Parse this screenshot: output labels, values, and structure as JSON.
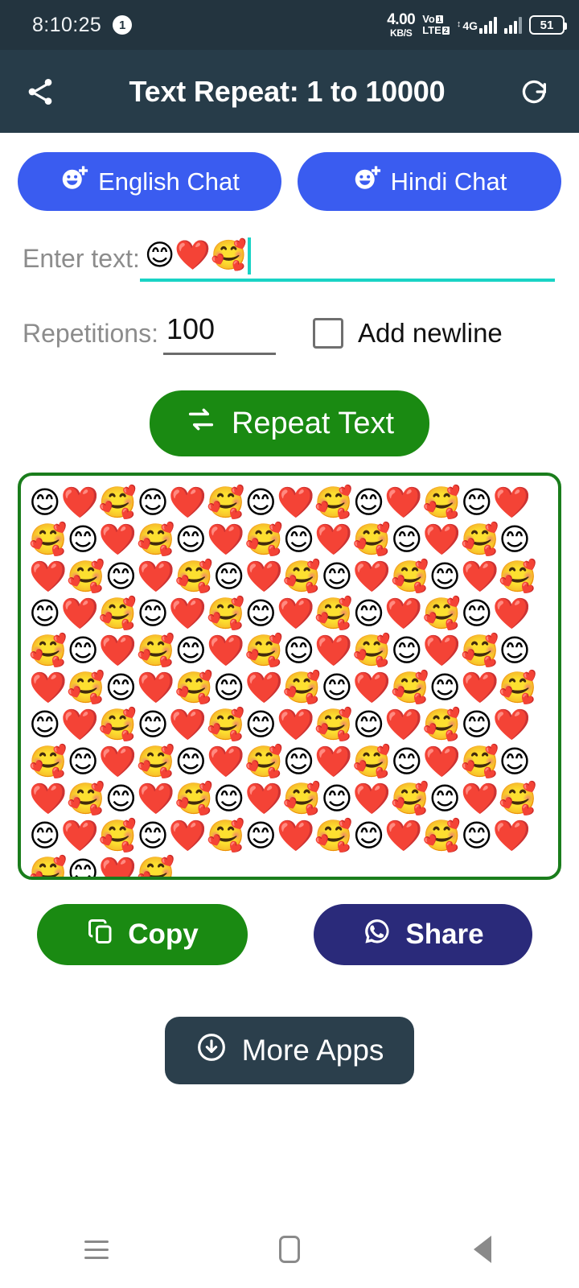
{
  "statusbar": {
    "time": "8:10:25",
    "notification_count": "1",
    "net_speed_value": "4.00",
    "net_speed_unit": "KB/S",
    "volte_top": "Vo",
    "volte_bottom": "LTE",
    "sim1_badge": "1",
    "sim2_badge": "2",
    "network_type": "4G",
    "battery_percent": "51",
    "bg_color": "#23343f"
  },
  "appbar": {
    "share_icon": "share-icon",
    "title": "Text Repeat: 1 to 10000",
    "refresh_icon": "refresh-icon",
    "bg_color": "#273c49"
  },
  "chat_buttons": [
    {
      "label": "English Chat",
      "icon": "emoji-add-icon",
      "color": "#3a5cf0"
    },
    {
      "label": "Hindi Chat",
      "icon": "emoji-add-icon",
      "color": "#3a5cf0"
    }
  ],
  "input_section": {
    "enter_text_label": "Enter text:",
    "enter_text_value": "😊❤️🥰",
    "enter_text_placeholder": "",
    "underline_color": "#19d3c5",
    "repetitions_label": "Repetitions:",
    "repetitions_value": "100",
    "repetitions_placeholder": "",
    "add_newline_label": "Add newline",
    "add_newline_checked": false
  },
  "repeat_button": {
    "label": "Repeat Text",
    "icon": "repeat-icon",
    "color": "#1a8a12"
  },
  "result": {
    "unit": "😊❤️🥰",
    "repeats_shown": 48,
    "border_color": "#1a7d1c"
  },
  "actions": [
    {
      "label": "Copy",
      "icon": "copy-icon",
      "color": "#1a8a12"
    },
    {
      "label": "Share",
      "icon": "whatsapp-icon",
      "color": "#2a2a7a"
    }
  ],
  "more_apps": {
    "label": "More Apps",
    "icon": "download-circle-icon",
    "color": "#2b3f4c"
  },
  "navbar": {
    "recents": "recents-icon",
    "home": "home-icon",
    "back": "back-icon"
  }
}
